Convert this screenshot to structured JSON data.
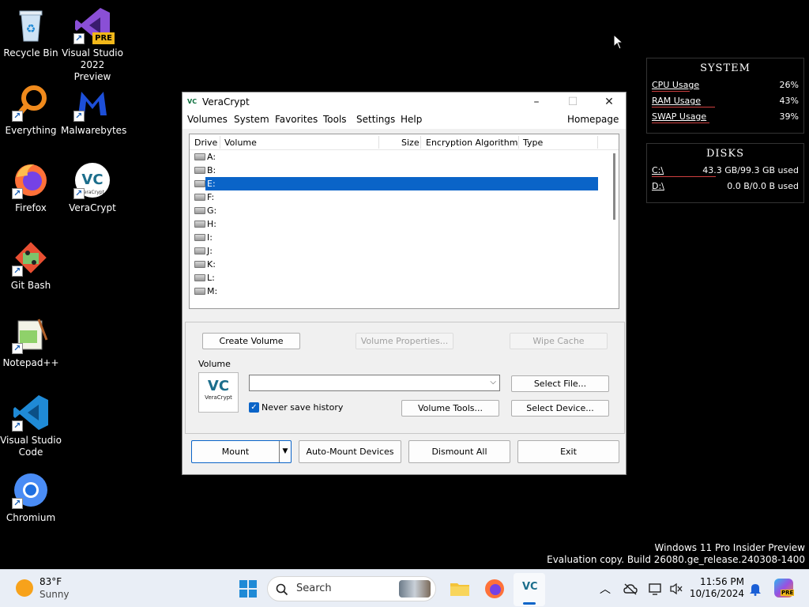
{
  "desktop": {
    "icons": [
      {
        "label": "Recycle Bin"
      },
      {
        "label": "Visual Studio 2022 Preview"
      },
      {
        "label": "Everything"
      },
      {
        "label": "Malwarebytes"
      },
      {
        "label": "Firefox"
      },
      {
        "label": "VeraCrypt"
      },
      {
        "label": "Git Bash"
      },
      {
        "label": "Notepad++"
      },
      {
        "label": "Visual Studio Code"
      },
      {
        "label": "Chromium"
      }
    ],
    "vs_badge": "PRE",
    "vc_logo_text": "VeraCrypt"
  },
  "system_widget": {
    "title": "SYSTEM",
    "rows": [
      {
        "label": "CPU Usage",
        "value": "26%",
        "fraction": 0.26
      },
      {
        "label": "RAM Usage",
        "value": "43%",
        "fraction": 0.43
      },
      {
        "label": "SWAP Usage",
        "value": "39%",
        "fraction": 0.39
      }
    ]
  },
  "disks_widget": {
    "title": "DISKS",
    "rows": [
      {
        "label": "C:\\",
        "value": "43.3 GB/99.3 GB used",
        "fraction": 0.436
      },
      {
        "label": "D:\\",
        "value": "0.0 B/0.0 B used",
        "fraction": 0
      }
    ]
  },
  "window": {
    "title": "VeraCrypt",
    "logo_text": "VC",
    "minimize": "–",
    "maximize": "☐",
    "close": "✕",
    "menu": [
      "Volumes",
      "System",
      "Favorites",
      "Tools",
      "Settings",
      "Help"
    ],
    "homepage": "Homepage",
    "columns": {
      "drive": "Drive",
      "volume": "Volume",
      "size": "Size",
      "algorithm": "Encryption Algorithm",
      "type": "Type"
    },
    "drives": [
      "A:",
      "B:",
      "E:",
      "F:",
      "G:",
      "H:",
      "I:",
      "J:",
      "K:",
      "L:",
      "M:"
    ],
    "selected_drive": "E:",
    "buttons": {
      "create_volume": "Create Volume",
      "volume_properties": "Volume Properties...",
      "wipe_cache": "Wipe Cache",
      "select_file": "Select File...",
      "volume_tools": "Volume Tools...",
      "select_device": "Select Device...",
      "mount": "Mount",
      "auto_mount": "Auto-Mount Devices",
      "dismount_all": "Dismount All",
      "exit": "Exit"
    },
    "volume_group_label": "Volume",
    "volume_path_value": "",
    "never_save_history": "Never save history",
    "vc_logo_text": "VeraCrypt"
  },
  "watermark": {
    "line1": "Windows 11 Pro Insider Preview",
    "line2": "Evaluation copy. Build 26080.ge_release.240308-1400"
  },
  "taskbar": {
    "weather_temp": "83°F",
    "weather_desc": "Sunny",
    "search_label": "Search",
    "time": "11:56 PM",
    "date": "10/16/2024",
    "copilot_badge": "PRE"
  },
  "colors": {
    "selection": "#0a64c8",
    "taskbar": "#e9eef6",
    "widget_bar": "#d04040"
  }
}
